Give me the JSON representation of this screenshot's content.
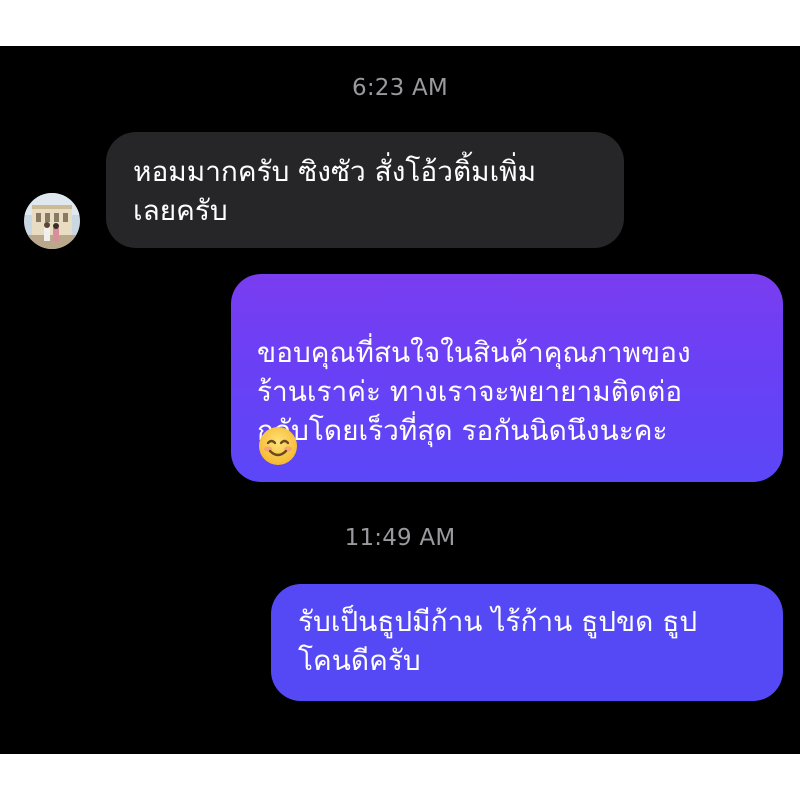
{
  "conversation": {
    "timestamps": [
      "6:23 AM",
      "11:49 AM"
    ],
    "messages": [
      {
        "direction": "incoming",
        "text": "หอมมากครับ ซิงซัว สั่งโอ้วติ้มเพิ่ม\nเลยครับ"
      },
      {
        "direction": "outgoing",
        "text": "ขอบคุณที่สนใจในสินค้าคุณภาพของ\nร้านเราค่ะ ทางเราจะพยายามติดต่อ\nกลับโดยเร็วที่สุด รอกันนิดนึงนะคะ",
        "emoji": "smiling-face-icon"
      },
      {
        "direction": "outgoing",
        "text": "รับเป็นธูปมีก้าน ไร้ก้าน ธูปขด ธูป\nโคนดีครับ"
      }
    ]
  },
  "colors": {
    "background": "#000000",
    "incoming_bubble": "#262629",
    "outgoing_bubble_top": "#7a3df0",
    "outgoing_bubble_bottom": "#5549f5",
    "timestamp_text": "#9a9a9e",
    "message_text": "#ffffff"
  }
}
